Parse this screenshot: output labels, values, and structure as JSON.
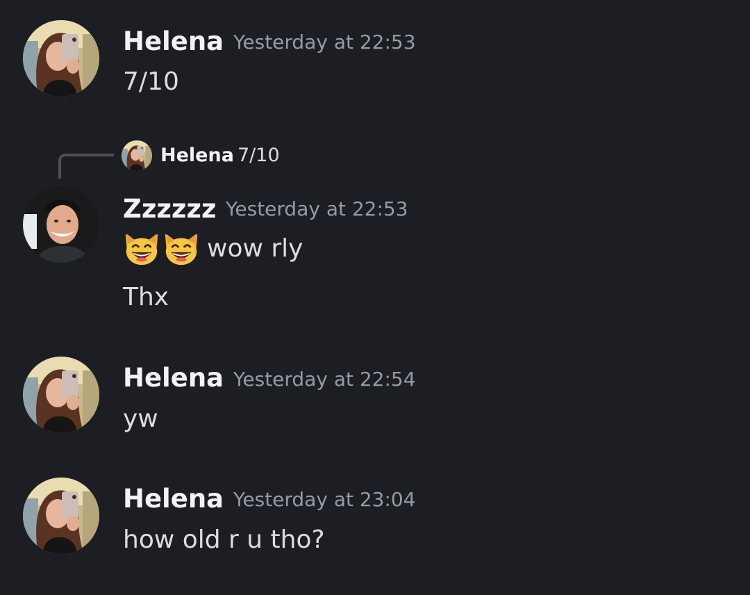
{
  "messages": [
    {
      "author": "Helena",
      "timestamp": "Yesterday at 22:53",
      "lines": [
        "7/10"
      ]
    },
    {
      "reply_to": {
        "author": "Helena",
        "text": "7/10"
      },
      "author": "Zzzzzz",
      "timestamp": "Yesterday at 22:53",
      "emoji": [
        "smiling-cat-icon",
        "smiling-cat-icon"
      ],
      "lines": [
        "wow rly",
        "Thx"
      ]
    },
    {
      "author": "Helena",
      "timestamp": "Yesterday at 22:54",
      "lines": [
        "yw"
      ]
    },
    {
      "author": "Helena",
      "timestamp": "Yesterday at 23:04",
      "lines": [
        "how old r u tho?"
      ]
    }
  ],
  "colors": {
    "background": "#1d1e23",
    "author": "#f2f3f5",
    "timestamp": "#949ba4",
    "message_text": "#dbdee1",
    "reply_line": "#4e5058"
  }
}
